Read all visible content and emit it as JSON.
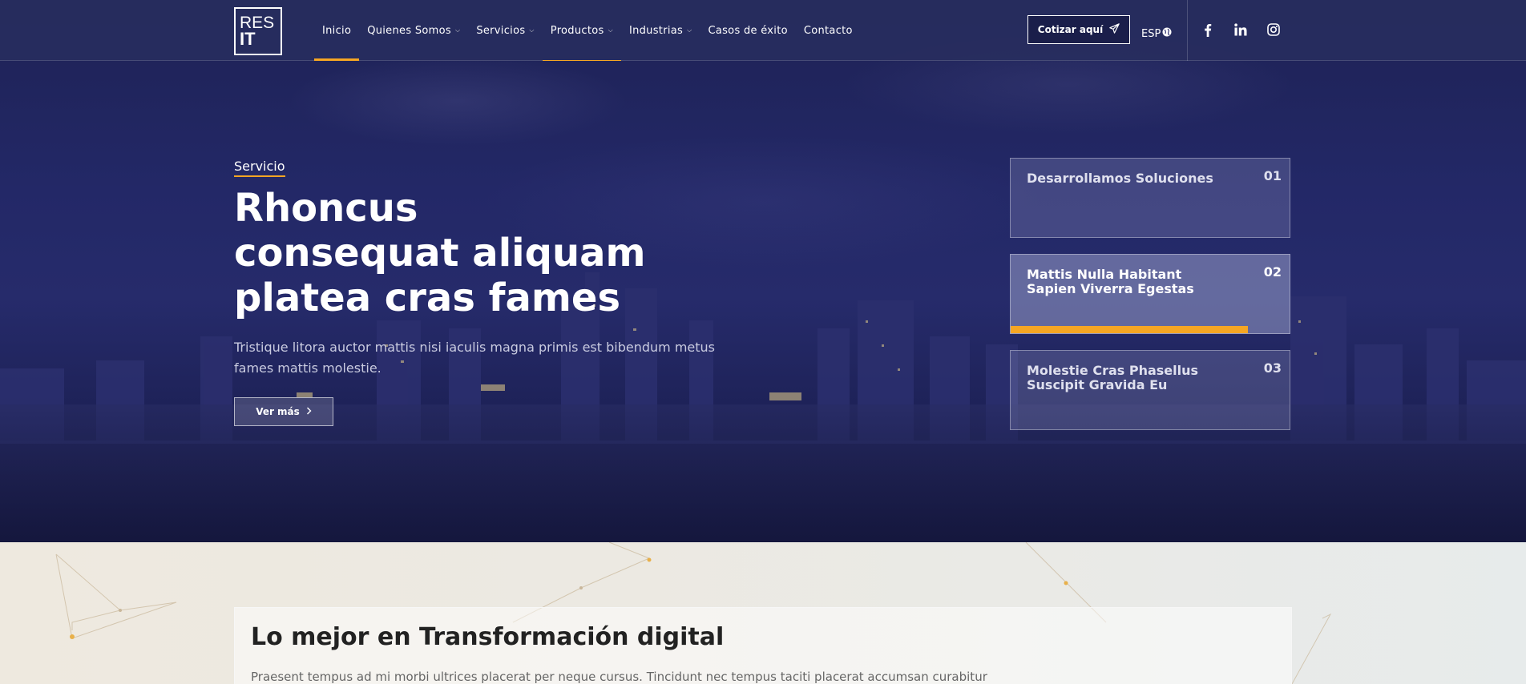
{
  "colors": {
    "accent": "#f5a623",
    "navy": "#1d2150"
  },
  "nav": {
    "logo_line1": "RES",
    "logo_line2": "IT",
    "items": [
      {
        "label": "Inicio",
        "dropdown": false
      },
      {
        "label": "Quienes Somos",
        "dropdown": true
      },
      {
        "label": "Servicios",
        "dropdown": true
      },
      {
        "label": "Productos",
        "dropdown": true
      },
      {
        "label": "Industrias",
        "dropdown": true
      },
      {
        "label": "Casos de éxito",
        "dropdown": false
      },
      {
        "label": "Contacto",
        "dropdown": false
      }
    ],
    "cta_label": "Cotizar aquí",
    "lang_label": "ESP",
    "social_icons": [
      "facebook-icon",
      "linkedin-icon",
      "instagram-icon"
    ]
  },
  "hero": {
    "eyebrow": "Servicio",
    "title": "Rhoncus consequat aliquam platea cras fames",
    "description": "Tristique litora auctor mattis nisi iaculis magna primis est bibendum metus fames mattis molestie.",
    "button_label": "Ver más"
  },
  "slides": [
    {
      "title": "Desarrollamos Soluciones",
      "number": "01"
    },
    {
      "title": "Mattis Nulla Habitant Sapien Viverra Egestas",
      "number": "02",
      "progress": 0.85
    },
    {
      "title": "Molestie Cras Phasellus Suscipit Gravida Eu",
      "number": "03"
    }
  ],
  "section": {
    "title": "Lo mejor en Transformación digital",
    "text": "Praesent tempus ad mi morbi ultrices placerat per neque cursus. Tincidunt nec tempus taciti placerat accumsan curabitur"
  }
}
